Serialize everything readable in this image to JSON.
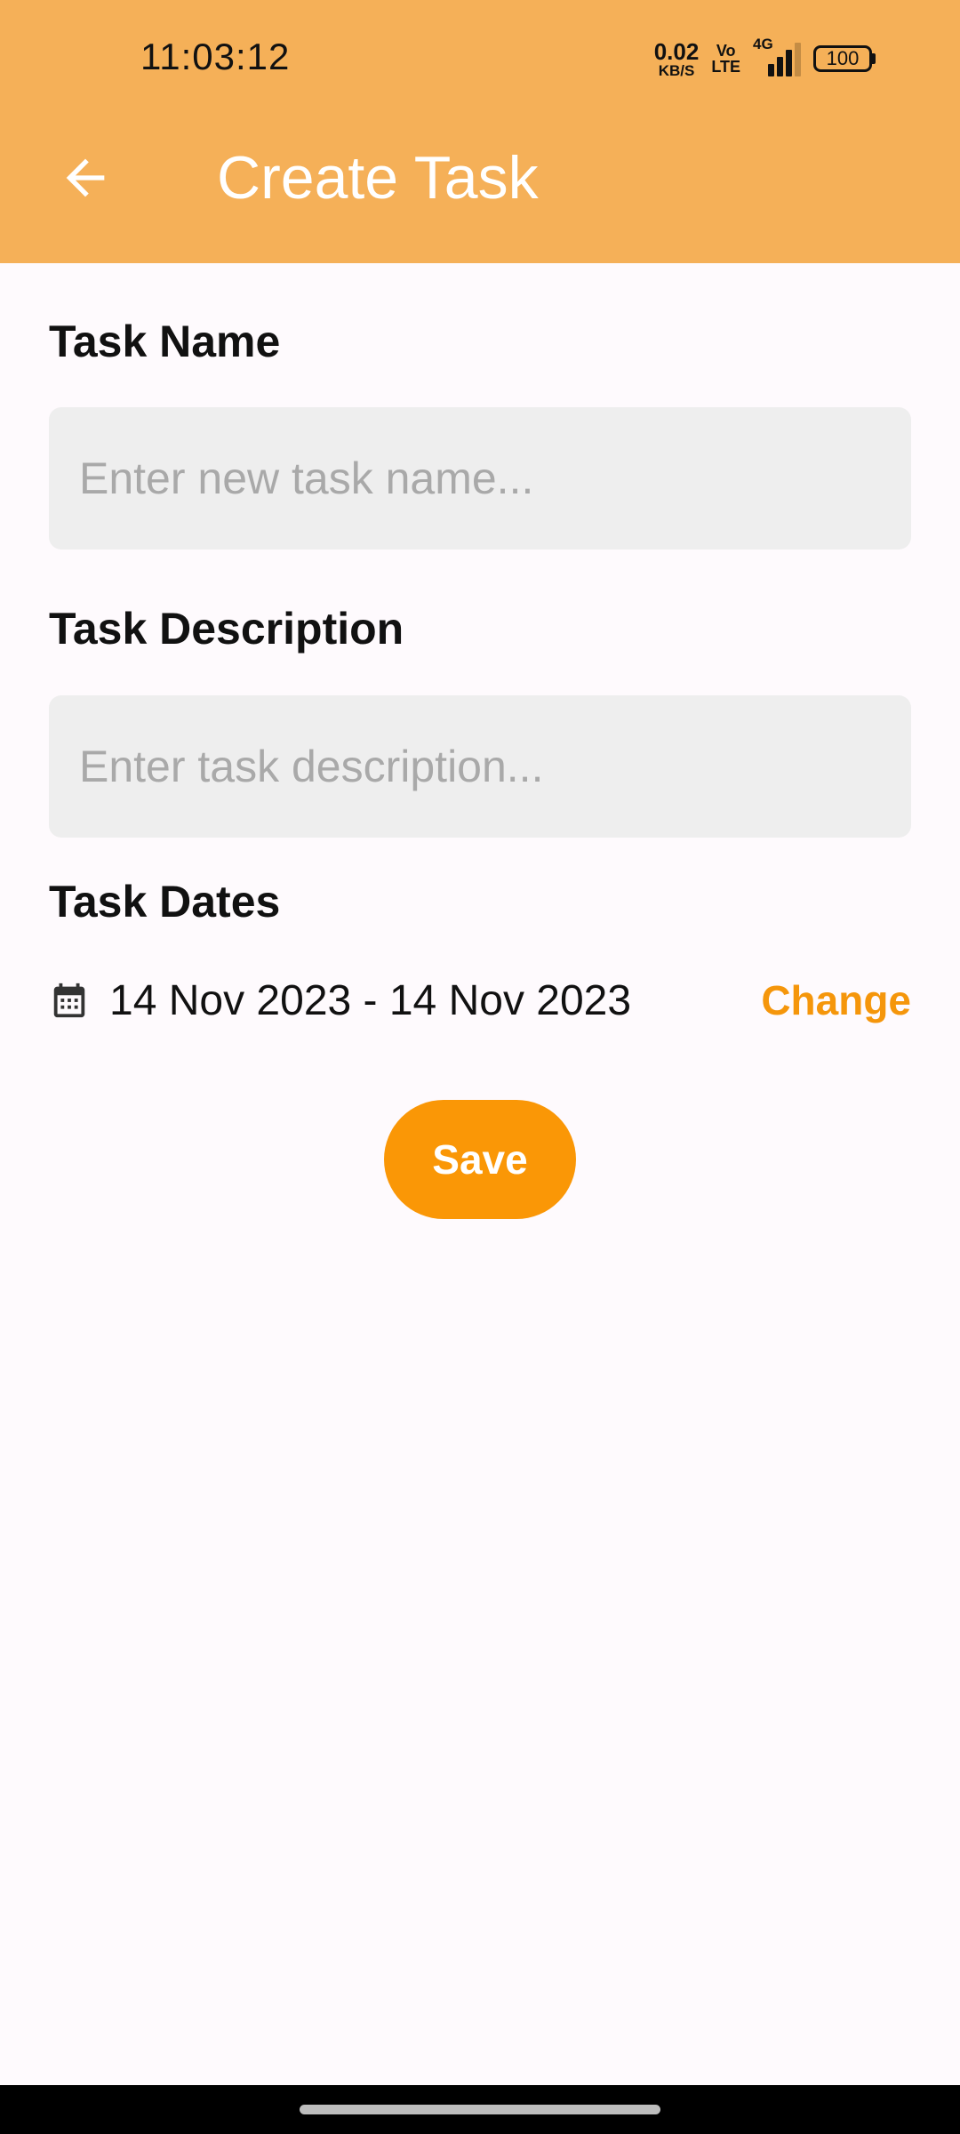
{
  "status_bar": {
    "time": "11:03:12",
    "net_speed_value": "0.02",
    "net_speed_unit": "KB/S",
    "volte_top": "Vo",
    "volte_bottom": "LTE",
    "network_type": "4G",
    "battery_level": "100"
  },
  "app_bar": {
    "title": "Create Task",
    "back_icon": "arrow-left-icon"
  },
  "form": {
    "task_name": {
      "label": "Task Name",
      "value": "",
      "placeholder": "Enter new task name..."
    },
    "task_description": {
      "label": "Task Description",
      "value": "",
      "placeholder": "Enter task description..."
    },
    "task_dates": {
      "label": "Task Dates",
      "range": "14 Nov 2023 - 14 Nov 2023",
      "icon": "calendar-icon",
      "change_label": "Change"
    },
    "save_label": "Save"
  },
  "colors": {
    "app_bar": "#f5b058",
    "accent": "#fa9706",
    "link": "#f5960b",
    "background": "#fefafd",
    "field_bg": "#eeeeee"
  }
}
